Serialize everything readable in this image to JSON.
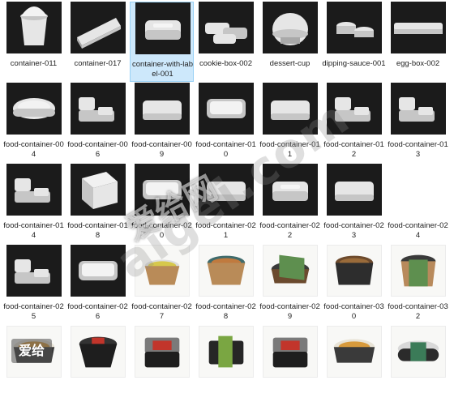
{
  "items": [
    {
      "label": "container-011",
      "theme": "dark",
      "shape": "cup"
    },
    {
      "label": "container-017",
      "theme": "dark",
      "shape": "wedge"
    },
    {
      "label": "container-with-label-001",
      "theme": "dark",
      "shape": "hinged",
      "selected": true
    },
    {
      "label": "cookie-box-002",
      "theme": "dark",
      "shape": "stack"
    },
    {
      "label": "dessert-cup",
      "theme": "dark",
      "shape": "dome"
    },
    {
      "label": "dipping-sauce-001",
      "theme": "dark",
      "shape": "sauce"
    },
    {
      "label": "egg-box-002",
      "theme": "dark",
      "shape": "egg"
    },
    {
      "label": "food-container-004",
      "theme": "dark",
      "shape": "oval"
    },
    {
      "label": "food-container-006",
      "theme": "dark",
      "shape": "clamshell"
    },
    {
      "label": "food-container-009",
      "theme": "dark",
      "shape": "rect"
    },
    {
      "label": "food-container-010",
      "theme": "dark",
      "shape": "tray"
    },
    {
      "label": "food-container-011",
      "theme": "dark",
      "shape": "rect"
    },
    {
      "label": "food-container-012",
      "theme": "dark",
      "shape": "clamshell"
    },
    {
      "label": "food-container-013",
      "theme": "dark",
      "shape": "clamshell"
    },
    {
      "label": "food-container-014",
      "theme": "dark",
      "shape": "clamshell"
    },
    {
      "label": "food-container-018",
      "theme": "dark",
      "shape": "box"
    },
    {
      "label": "food-container-020",
      "theme": "dark",
      "shape": "tray"
    },
    {
      "label": "food-container-021",
      "theme": "dark",
      "shape": "rect"
    },
    {
      "label": "food-container-022",
      "theme": "dark",
      "shape": "hinged"
    },
    {
      "label": "food-container-023",
      "theme": "dark",
      "shape": "rect"
    },
    {
      "label": "food-container-024",
      "theme": "light-plain",
      "shape": "none"
    },
    {
      "label": "food-container-025",
      "theme": "dark",
      "shape": "clamshell"
    },
    {
      "label": "food-container-026",
      "theme": "dark",
      "shape": "tray"
    },
    {
      "label": "food-container-027",
      "theme": "light",
      "shape": "bowl-salad"
    },
    {
      "label": "food-container-028",
      "theme": "light",
      "shape": "bowl-food"
    },
    {
      "label": "food-container-029",
      "theme": "light",
      "shape": "bowl-green"
    },
    {
      "label": "food-container-030",
      "theme": "light",
      "shape": "bowl-dark"
    },
    {
      "label": "food-container-032",
      "theme": "light",
      "shape": "bowl-kraft"
    },
    {
      "label": "",
      "theme": "light",
      "shape": "bowl-clear"
    },
    {
      "label": "",
      "theme": "light",
      "shape": "bowl-black"
    },
    {
      "label": "",
      "theme": "light",
      "shape": "box-black"
    },
    {
      "label": "",
      "theme": "light",
      "shape": "box-green"
    },
    {
      "label": "",
      "theme": "light",
      "shape": "box-black"
    },
    {
      "label": "",
      "theme": "light",
      "shape": "bowl-clear"
    },
    {
      "label": "",
      "theme": "light",
      "shape": "oval-green"
    }
  ],
  "watermark": {
    "big": "爱给网",
    "diag": "aigei.com",
    "logo": "爱给"
  },
  "colors": {
    "selection": "#cde8fb",
    "selection_border": "#99d1f5",
    "thumb_dark": "#1b1b1b",
    "plastic": "#e4e4e4",
    "kraft": "#b88a5c",
    "green": "#5e8f4f"
  }
}
